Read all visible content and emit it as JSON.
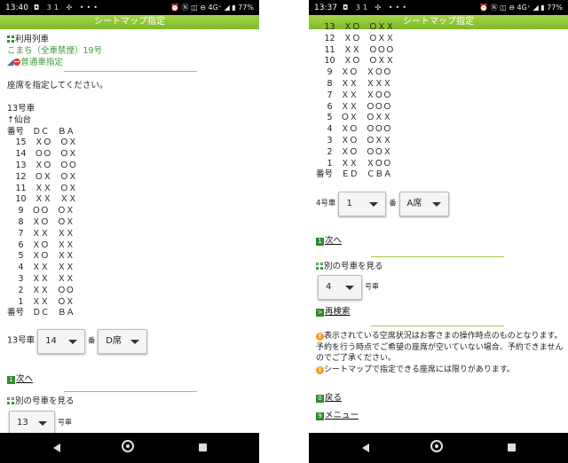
{
  "left": {
    "status": {
      "time": "13:40",
      "icons": "◘ 31 ✣ •••",
      "right": "⏰ Ⓝ ◫ ⊖ 4G⁺ ◢ ▮ 77%"
    },
    "title": "シートマップ指定",
    "train_heading": "利用列車",
    "train_name": "こまち（全車禁煙）19号",
    "seat_type": "普通車指定",
    "instruction": "座席を指定してください。",
    "car_label": "13号車",
    "direction": "↑仙台",
    "header_row": "番号　ＤＣ　ＢＡ",
    "rows": [
      "　15　ＸＯ　ＯＸ",
      "　14　ＯＯ　ＯＸ",
      "　13　ＸＯ　ＯＯ",
      "　12　ＯＸ　ＯＸ",
      "　11　ＸＸ　ＯＸ",
      "　10　ＸＸ　ＸＸ",
      "　 9　ＯＯ　ＯＸ",
      "　 8　ＸＯ　ＯＸ",
      "　 7　ＸＸ　ＸＸ",
      "　 6　ＸＯ　ＸＸ",
      "　 5　ＸＯ　ＸＸ",
      "　 4　ＸＸ　ＸＸ",
      "　 3　ＸＸ　ＸＸ",
      "　 2　ＸＸ　ＯＯ",
      "　 1　ＸＸ　ＯＸ"
    ],
    "footer_row": "番号　ＤＣ　ＢＡ",
    "car_select_label": "13号車",
    "row_select_value": "14",
    "ban_label": "番",
    "seat_select_value": "D席",
    "next_badge": "1",
    "next_label": "次へ",
    "other_car_label": "別の号車を見る",
    "car_select_value": "13",
    "car_suffix": "号車",
    "nav": {
      "back": "back-icon",
      "home": "home-icon",
      "recent": "recent-apps-icon"
    }
  },
  "right": {
    "status": {
      "time": "13:37",
      "icons": "◘ 31 ✣ •••",
      "right": "⏰ Ⓝ ◫ ⊖ 4G⁺ ◢ ▮ 77%"
    },
    "title": "シートマップ指定",
    "partial_row": "　13　ＸＯ　ＯＸＸ",
    "rows": [
      "　12　ＸＯ　ＯＸＸ",
      "　11　ＸＸ　ＯＯＯ",
      "　10　ＸＯ　ＯＸＸ",
      "　 9　ＸＯ　ＸＯＯ",
      "　 8　ＸＸ　ＸＸＸ",
      "　 7　ＸＸ　ＸＯＯ",
      "　 6　ＸＸ　ＯＯＯ",
      "　 5　ＯＸ　ＯＸＸ",
      "　 4　ＸＯ　ＯＯＯ",
      "　 3　ＸＯ　ＯＸＸ",
      "　 2　ＸＯ　ＯＯＸ",
      "　 1　ＸＸ　ＸＯＯ"
    ],
    "footer_row": "番号　ＥＤ　ＣＢＡ",
    "car_select_label": "4号車",
    "row_select_value": "1",
    "ban_label": "番",
    "seat_select_value": "A席",
    "next_badge": "1",
    "next_label": "次へ",
    "other_car_label": "別の号車を見る",
    "car_select_value": "4",
    "car_suffix": "号車",
    "research_label": "再検索",
    "notice1": "表示されている空席状況はお客さまの操作時点のものとなります。予約を行う時点でご希望の座席が空いていない場合、予約できませんのでご了承ください。",
    "notice2": "シートマップで指定できる座席には限りがあります。",
    "back_badge": "0",
    "back_label": "戻る",
    "menu_badge": "9",
    "menu_label": "メニュー",
    "nav": {
      "back": "back-icon",
      "home": "home-icon",
      "recent": "recent-apps-icon"
    }
  }
}
